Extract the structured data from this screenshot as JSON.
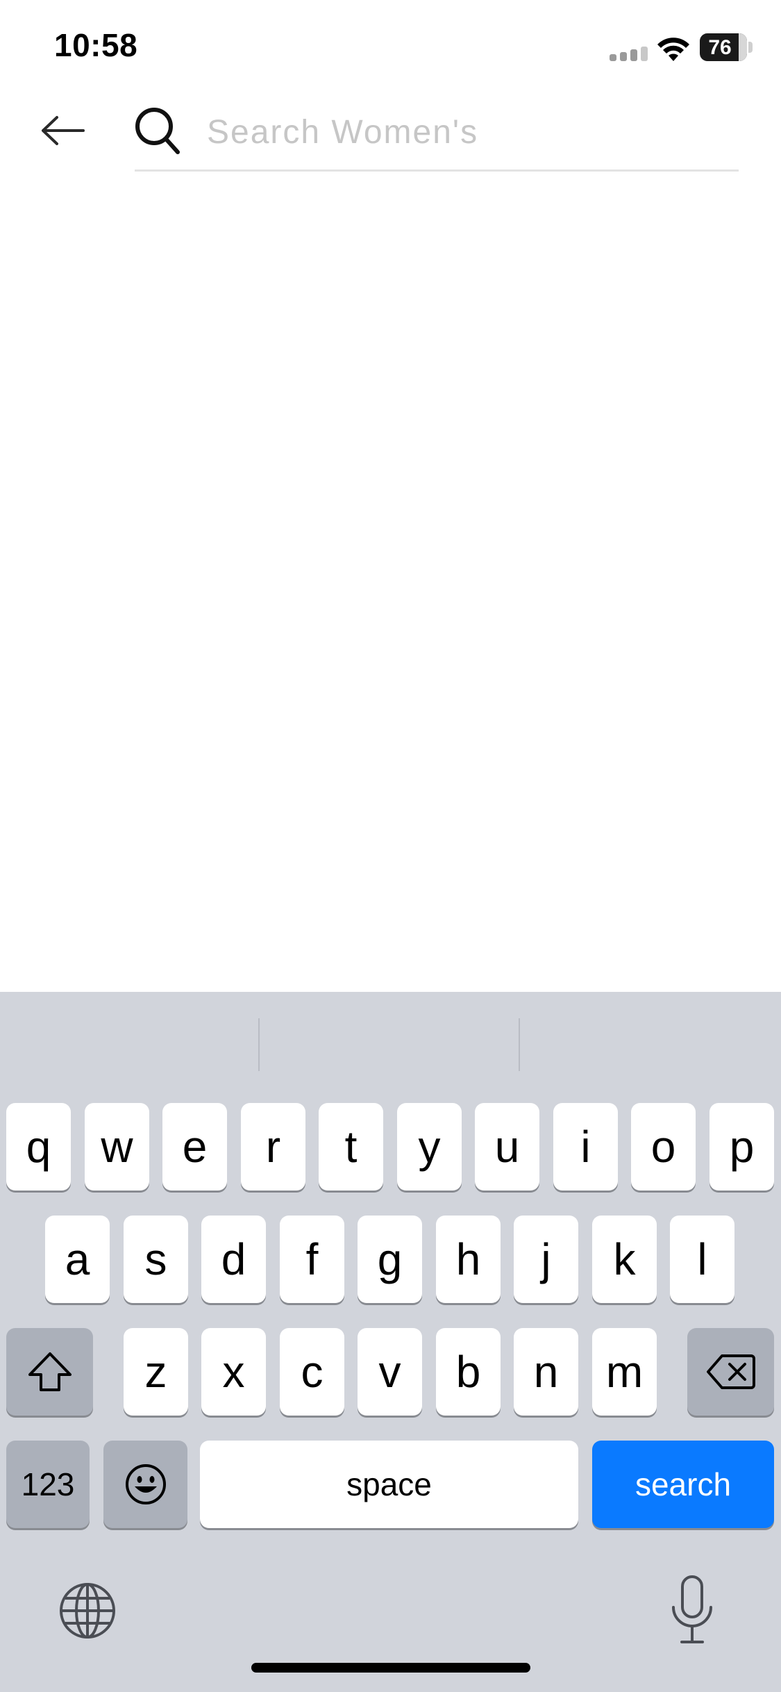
{
  "status_bar": {
    "time": "10:58",
    "battery": "76"
  },
  "search": {
    "placeholder": "Search Women's",
    "value": ""
  },
  "keyboard": {
    "row1": [
      "q",
      "w",
      "e",
      "r",
      "t",
      "y",
      "u",
      "i",
      "o",
      "p"
    ],
    "row2": [
      "a",
      "s",
      "d",
      "f",
      "g",
      "h",
      "j",
      "k",
      "l"
    ],
    "row3": [
      "z",
      "x",
      "c",
      "v",
      "b",
      "n",
      "m"
    ],
    "numbers_label": "123",
    "space_label": "space",
    "return_label": "search"
  },
  "colors": {
    "accent": "#0a7aff",
    "keyboard_bg": "#d1d4db"
  },
  "icons": [
    "back-arrow-icon",
    "search-icon",
    "shift-icon",
    "backspace-icon",
    "emoji-icon",
    "globe-icon",
    "microphone-icon",
    "wifi-icon",
    "signal-icon",
    "battery-icon"
  ]
}
